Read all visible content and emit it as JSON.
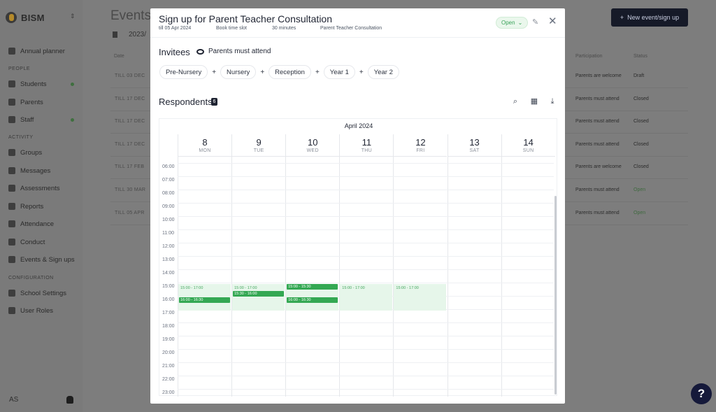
{
  "app": {
    "brand": "BISM",
    "page_title": "Events",
    "new_event_label": "New event/sign up",
    "academic_year": "2023/",
    "user_initials": "AS",
    "help_label": "?"
  },
  "sidebar": {
    "items": [
      {
        "label": "Annual planner"
      },
      {
        "section": "PEOPLE"
      },
      {
        "label": "Students",
        "dot": true
      },
      {
        "label": "Parents"
      },
      {
        "label": "Staff",
        "dot": true
      },
      {
        "section": "ACTIVITY"
      },
      {
        "label": "Groups"
      },
      {
        "label": "Messages"
      },
      {
        "label": "Assessments"
      },
      {
        "label": "Reports"
      },
      {
        "label": "Attendance"
      },
      {
        "label": "Conduct"
      },
      {
        "label": "Events & Sign ups"
      },
      {
        "section": "CONFIGURATION"
      },
      {
        "label": "School Settings"
      },
      {
        "label": "User Roles"
      }
    ]
  },
  "events_table": {
    "headers": {
      "date": "Date",
      "participation": "Participation",
      "status": "Status"
    },
    "rows": [
      {
        "date": "TILL 03 DEC",
        "attendance": "Parents are welcome",
        "status": "Draft"
      },
      {
        "date": "TILL 17 DEC",
        "attendance": "Parents must attend",
        "status": "Closed"
      },
      {
        "date": "TILL 17 DEC",
        "attendance": "Parents must attend",
        "status": "Closed"
      },
      {
        "date": "TILL 17 DEC",
        "attendance": "Parents must attend",
        "status": "Closed"
      },
      {
        "date": "TILL 17 FEB",
        "attendance": "Parents are welcome",
        "status": "Closed"
      },
      {
        "date": "TILL 30 MAR",
        "attendance": "Parents must attend",
        "status": "Open"
      },
      {
        "date": "TILL 05 APR",
        "attendance": "Parents must attend",
        "status": "Open"
      }
    ]
  },
  "modal": {
    "title": "Sign up for Parent Teacher Consultation",
    "meta": [
      "till 05 Apr 2024",
      "Book time slot",
      "30 minutes",
      "Parent Teacher Consultation"
    ],
    "status": "Open",
    "invitees_title": "Invitees",
    "attendance_label": "Parents must attend",
    "invitee_groups": [
      "Pre-Nursery",
      "Nursery",
      "Reception",
      "Year 1",
      "Year 2"
    ],
    "respondents_title": "Respondents",
    "respondents_count": "6"
  },
  "calendar": {
    "month_label": "April 2024",
    "days": [
      {
        "num": "8",
        "name": "MON"
      },
      {
        "num": "9",
        "name": "TUE"
      },
      {
        "num": "10",
        "name": "WED"
      },
      {
        "num": "11",
        "name": "THU"
      },
      {
        "num": "12",
        "name": "FRI"
      },
      {
        "num": "13",
        "name": "SAT"
      },
      {
        "num": "14",
        "name": "SUN"
      }
    ],
    "hours": [
      "06:00",
      "07:00",
      "08:00",
      "09:00",
      "10:00",
      "11:00",
      "12:00",
      "13:00",
      "14:00",
      "15:00",
      "16:00",
      "17:00",
      "18:00",
      "19:00",
      "20:00",
      "21:00",
      "22:00",
      "23:00"
    ],
    "availability": [
      {
        "day": 0,
        "start": 15,
        "end": 17,
        "label": "15:00 - 17:00"
      },
      {
        "day": 1,
        "start": 15,
        "end": 17,
        "label": "15:00 - 17:00"
      },
      {
        "day": 2,
        "start": 15,
        "end": 17,
        "label": ""
      },
      {
        "day": 3,
        "start": 15,
        "end": 17,
        "label": "15:00 - 17:00"
      },
      {
        "day": 4,
        "start": 15,
        "end": 17,
        "label": "15:00 - 17:00"
      }
    ],
    "bookings": [
      {
        "day": 0,
        "start": 16,
        "label": "16:00 - 16:30"
      },
      {
        "day": 1,
        "start": 15.5,
        "label": "15:30 - 16:00"
      },
      {
        "day": 2,
        "start": 15,
        "label": "15:00 - 15:30"
      },
      {
        "day": 2,
        "start": 16,
        "label": "16:00 - 16:30"
      }
    ]
  }
}
